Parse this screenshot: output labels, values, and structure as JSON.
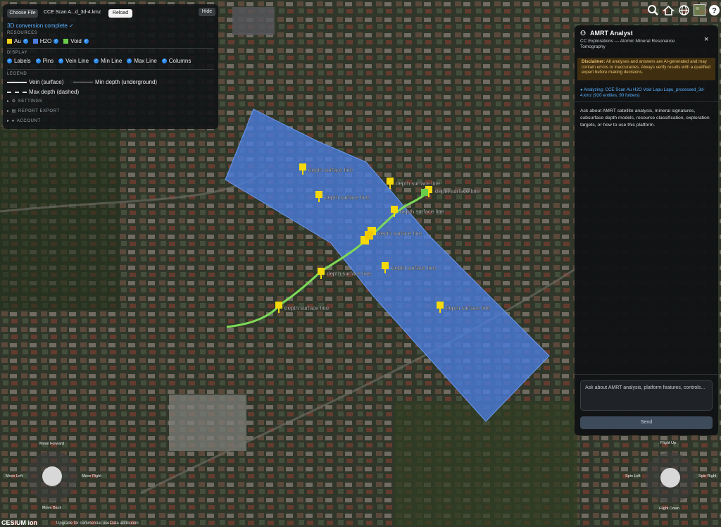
{
  "panel": {
    "choose_file": "Choose File",
    "file_name": "CCE Scan A...d_3d-4.kmz",
    "reload": "Reload",
    "hide": "Hide",
    "status": "3D conversion complete ✓",
    "resources_heading": "RESOURCES",
    "resources": [
      {
        "label": "Au",
        "color": "#f2d21a"
      },
      {
        "label": "H2O",
        "color": "#4a7de0"
      },
      {
        "label": "Void",
        "color": "#6acd4a"
      }
    ],
    "display_heading": "DISPLAY",
    "display": [
      "Labels",
      "Pins",
      "Vein Line",
      "Min Line",
      "Max Line",
      "Columns"
    ],
    "legend_heading": "LEGEND",
    "legend": {
      "surface": "Vein (surface)",
      "min": "Min depth (underground)",
      "max": "Max depth (dashed)"
    },
    "settings": "SETTINGS",
    "report": "REPORT EXPORT",
    "account": "ACCOUNT"
  },
  "ai": {
    "title": "AMRT Analyst",
    "subtitle": "CC Explorations — Atomic Mineral Resonance Tomography",
    "close": "×",
    "disclaimer_bold": "Disclaimer:",
    "disclaimer": "All analyses and answers are AI-generated and may contain errors or inaccuracies. Always verify results with a qualified expert before making decisions.",
    "analyzing_label": "Analyzing:",
    "analyzing_file": "CCE Scan Au H2O Void Lapu Lapu_processed_3d-4.kmz (920 entities, 90 folders)",
    "intro": "Ask about AMRT satellite analysis, mineral signatures, subsurface depth models, resource classification, exploration targets, or how to use this platform.",
    "input_placeholder": "Ask about AMRT analysis, platform features, controls...",
    "send": "Send"
  },
  "map": {
    "pin_labels": [
      "depth surface line",
      "depth surface line",
      "depth surface line",
      "depth surface line",
      "depth surface line",
      "depth surface line",
      "depth surface line",
      "depth surface line",
      "depth surface line",
      "depth surface line"
    ]
  },
  "nav": {
    "move_forward": "Move Forward",
    "move_left": "Move Left",
    "move_right": "Move Right",
    "move_back": "Move Back",
    "flight_up": "Flight Up",
    "spin_left": "Spin Left",
    "spin_right": "Spin Right",
    "flight_down": "Flight Down"
  },
  "footer": {
    "brand": "CESIUM ion",
    "upgrade": "Upgrade for commercial use.",
    "attribution": "Data attribution"
  },
  "topbar": {
    "icons": [
      "search-icon",
      "home-icon",
      "globe-icon",
      "layers-icon",
      "help-icon"
    ]
  }
}
